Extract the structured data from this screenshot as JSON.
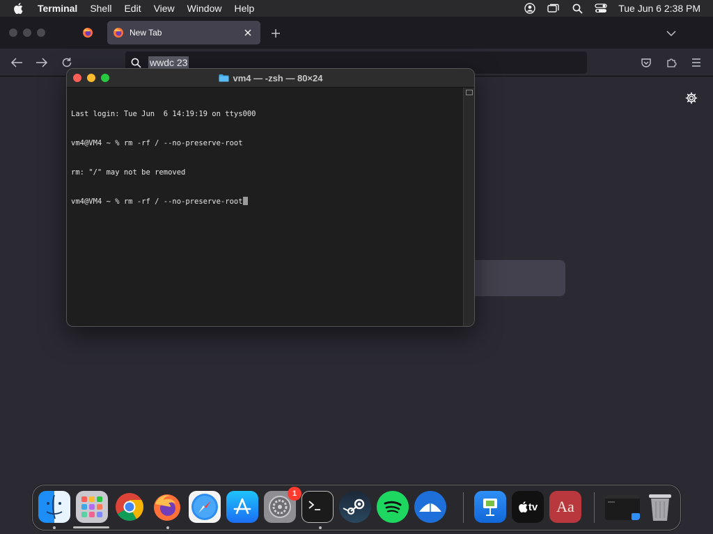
{
  "menubar": {
    "app_name": "Terminal",
    "menus": [
      "Shell",
      "Edit",
      "View",
      "Window",
      "Help"
    ],
    "clock": "Tue Jun 6  2:38 PM",
    "status_icons": [
      "user-account-icon",
      "screen-mirroring-icon",
      "spotlight-search-icon",
      "control-center-icon"
    ]
  },
  "firefox": {
    "tab_title": "New Tab",
    "url_text": "wwdc 23"
  },
  "terminal": {
    "title": "vm4 — -zsh — 80×24",
    "lines": [
      "Last login: Tue Jun  6 14:19:19 on ttys000",
      "vm4@VM4 ~ % rm -rf / --no-preserve-root",
      "rm: \"/\" may not be removed",
      "vm4@VM4 ~ % rm -rf / --no-preserve-root"
    ]
  },
  "dock": {
    "items": [
      {
        "name": "Finder",
        "running": true
      },
      {
        "name": "Launchpad",
        "running": false
      },
      {
        "name": "Google Chrome",
        "running": false
      },
      {
        "name": "Firefox",
        "running": true
      },
      {
        "name": "Safari",
        "running": false
      },
      {
        "name": "App Store",
        "running": false
      },
      {
        "name": "System Settings",
        "running": false,
        "badge": "1"
      },
      {
        "name": "Terminal",
        "running": true
      },
      {
        "name": "Steam",
        "running": false
      },
      {
        "name": "Spotify",
        "running": false
      },
      {
        "name": "Mail",
        "running": false
      },
      {
        "name": "Keynote",
        "running": false
      },
      {
        "name": "Apple TV",
        "running": false
      },
      {
        "name": "Dictionary",
        "running": false
      },
      {
        "name": "Terminal Window",
        "running": false
      },
      {
        "name": "Trash",
        "running": false
      }
    ],
    "badge_count": "1",
    "appletv_label": "tv",
    "dictionary_label": "Aa"
  },
  "colors": {
    "accent_close": "#ff5f57",
    "accent_minimize": "#febc2e",
    "accent_maximize": "#28c840",
    "firefox_bg": "#2b2a33",
    "terminal_bg": "#1e1e1e"
  }
}
